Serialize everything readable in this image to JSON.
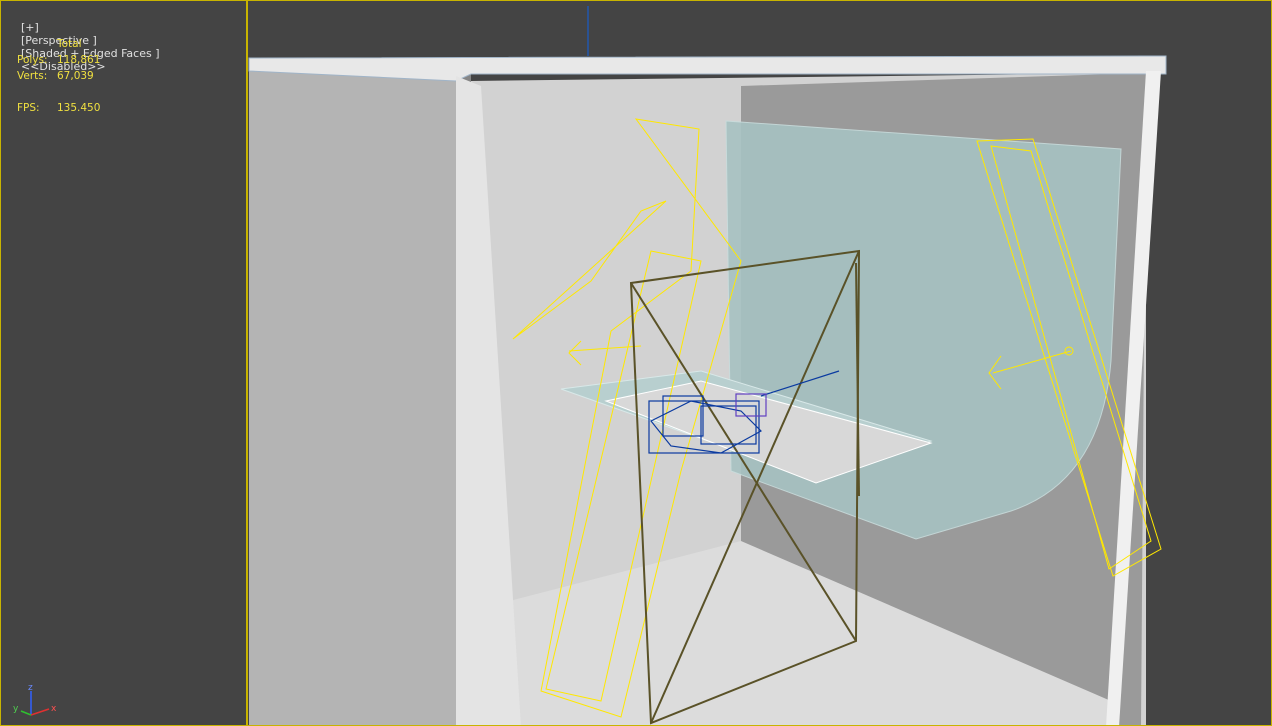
{
  "viewport": {
    "label_plus": "[+]",
    "label_view": "[Perspective ]",
    "label_shading": "[Shaded + Edged Faces ]",
    "label_disabled": "<<Disabled>>"
  },
  "stats": {
    "header": "Total",
    "polys_label": "Polys:",
    "polys_value": "118,861",
    "verts_label": "Verts:",
    "verts_value": "67,039",
    "fps_label": "FPS:",
    "fps_value": "135.450"
  },
  "axis_gizmo": {
    "z_label": "z",
    "y_label": "y",
    "x_label": "x"
  },
  "colors": {
    "frame_border": "#c8b400",
    "stats_text": "#f0e040",
    "light_wire": "#ffe800",
    "camera_wire": "#5a5228",
    "object_wire": "#0a3aa0",
    "cyc_panel": "#9fb8b8"
  }
}
